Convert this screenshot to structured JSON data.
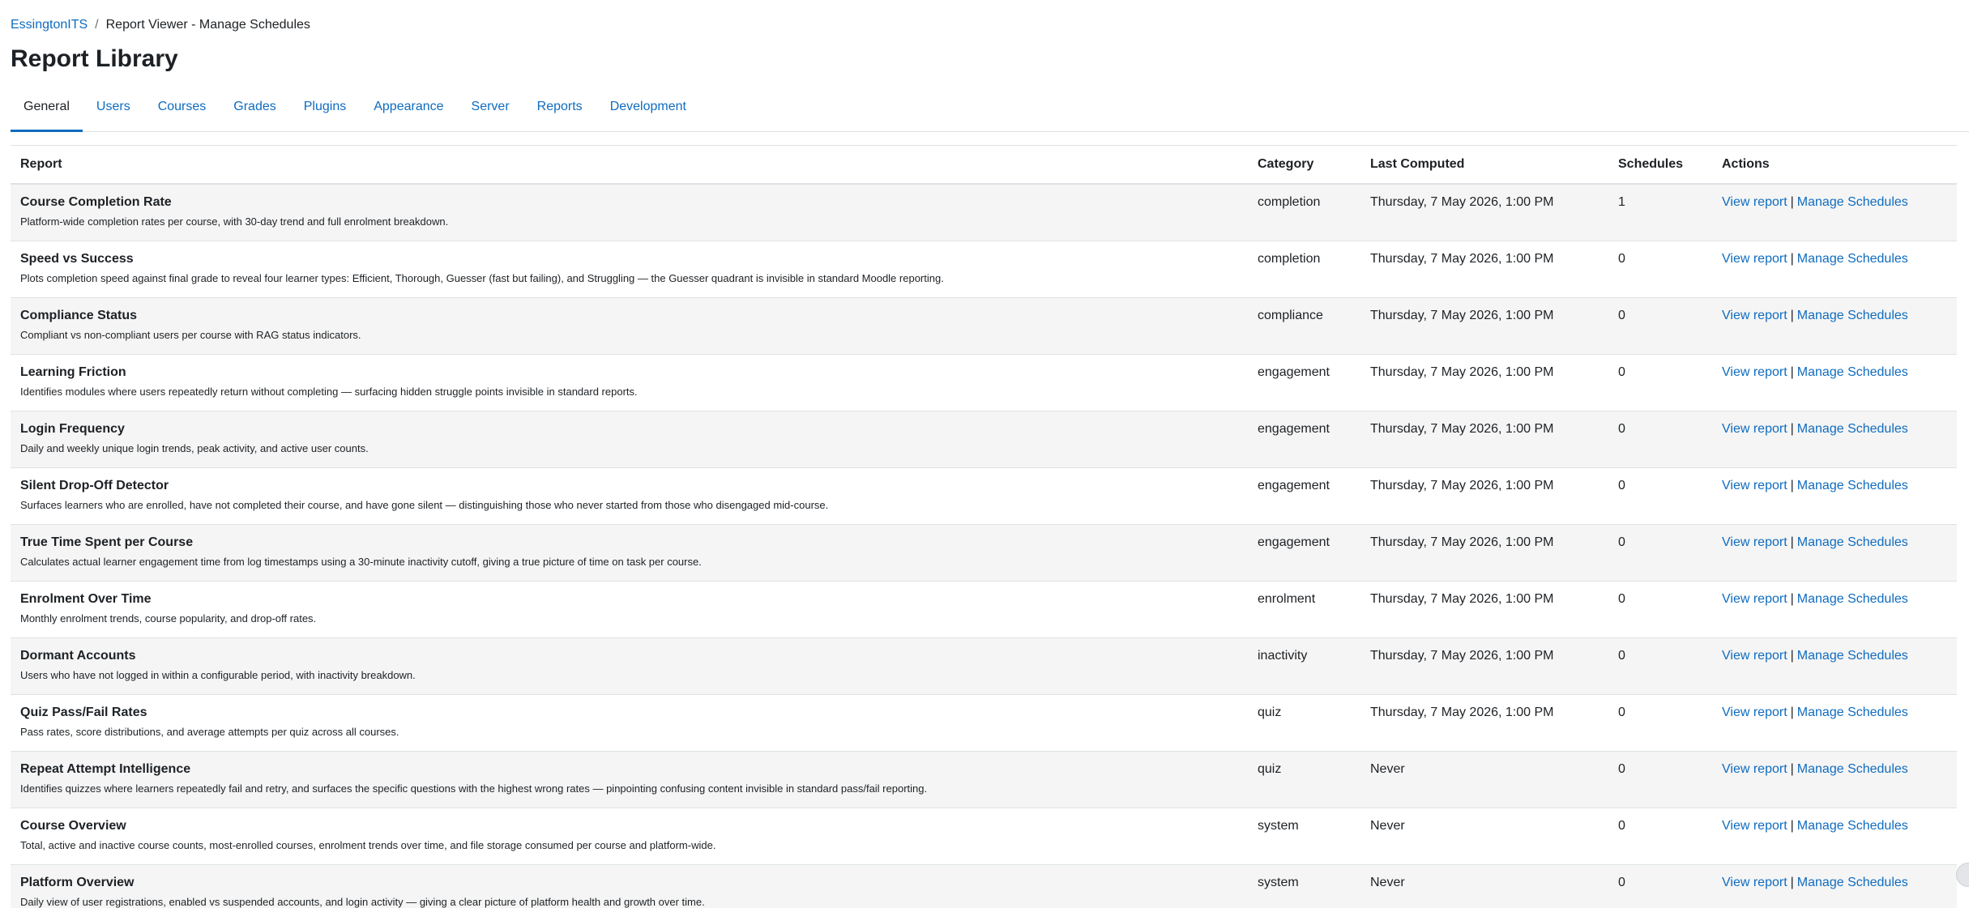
{
  "breadcrumb": {
    "root": "EssingtonITS",
    "separator": "/",
    "current": "Report Viewer - Manage Schedules"
  },
  "page_title": "Report Library",
  "tabs": [
    "General",
    "Users",
    "Courses",
    "Grades",
    "Plugins",
    "Appearance",
    "Server",
    "Reports",
    "Development"
  ],
  "active_tab": "General",
  "table": {
    "headers": {
      "report": "Report",
      "category": "Category",
      "last_computed": "Last Computed",
      "schedules": "Schedules",
      "actions": "Actions"
    },
    "action_labels": {
      "view": "View report",
      "separator": "|",
      "manage": "Manage Schedules"
    },
    "rows": [
      {
        "name": "Course Completion Rate",
        "desc": "Platform-wide completion rates per course, with 30-day trend and full enrolment breakdown.",
        "category": "completion",
        "last_computed": "Thursday, 7 May 2026, 1:00 PM",
        "schedules": "1"
      },
      {
        "name": "Speed vs Success",
        "desc": "Plots completion speed against final grade to reveal four learner types: Efficient, Thorough, Guesser (fast but failing), and Struggling — the Guesser quadrant is invisible in standard Moodle reporting.",
        "category": "completion",
        "last_computed": "Thursday, 7 May 2026, 1:00 PM",
        "schedules": "0"
      },
      {
        "name": "Compliance Status",
        "desc": "Compliant vs non-compliant users per course with RAG status indicators.",
        "category": "compliance",
        "last_computed": "Thursday, 7 May 2026, 1:00 PM",
        "schedules": "0"
      },
      {
        "name": "Learning Friction",
        "desc": "Identifies modules where users repeatedly return without completing — surfacing hidden struggle points invisible in standard reports.",
        "category": "engagement",
        "last_computed": "Thursday, 7 May 2026, 1:00 PM",
        "schedules": "0"
      },
      {
        "name": "Login Frequency",
        "desc": "Daily and weekly unique login trends, peak activity, and active user counts.",
        "category": "engagement",
        "last_computed": "Thursday, 7 May 2026, 1:00 PM",
        "schedules": "0"
      },
      {
        "name": "Silent Drop-Off Detector",
        "desc": "Surfaces learners who are enrolled, have not completed their course, and have gone silent — distinguishing those who never started from those who disengaged mid-course.",
        "category": "engagement",
        "last_computed": "Thursday, 7 May 2026, 1:00 PM",
        "schedules": "0"
      },
      {
        "name": "True Time Spent per Course",
        "desc": "Calculates actual learner engagement time from log timestamps using a 30-minute inactivity cutoff, giving a true picture of time on task per course.",
        "category": "engagement",
        "last_computed": "Thursday, 7 May 2026, 1:00 PM",
        "schedules": "0"
      },
      {
        "name": "Enrolment Over Time",
        "desc": "Monthly enrolment trends, course popularity, and drop-off rates.",
        "category": "enrolment",
        "last_computed": "Thursday, 7 May 2026, 1:00 PM",
        "schedules": "0"
      },
      {
        "name": "Dormant Accounts",
        "desc": "Users who have not logged in within a configurable period, with inactivity breakdown.",
        "category": "inactivity",
        "last_computed": "Thursday, 7 May 2026, 1:00 PM",
        "schedules": "0"
      },
      {
        "name": "Quiz Pass/Fail Rates",
        "desc": "Pass rates, score distributions, and average attempts per quiz across all courses.",
        "category": "quiz",
        "last_computed": "Thursday, 7 May 2026, 1:00 PM",
        "schedules": "0"
      },
      {
        "name": "Repeat Attempt Intelligence",
        "desc": "Identifies quizzes where learners repeatedly fail and retry, and surfaces the specific questions with the highest wrong rates — pinpointing confusing content invisible in standard pass/fail reporting.",
        "category": "quiz",
        "last_computed": "Never",
        "schedules": "0"
      },
      {
        "name": "Course Overview",
        "desc": "Total, active and inactive course counts, most-enrolled courses, enrolment trends over time, and file storage consumed per course and platform-wide.",
        "category": "system",
        "last_computed": "Never",
        "schedules": "0"
      },
      {
        "name": "Platform Overview",
        "desc": "Daily view of user registrations, enabled vs suspended accounts, and login activity — giving a clear picture of platform health and growth over time.",
        "category": "system",
        "last_computed": "Never",
        "schedules": "0"
      }
    ]
  }
}
